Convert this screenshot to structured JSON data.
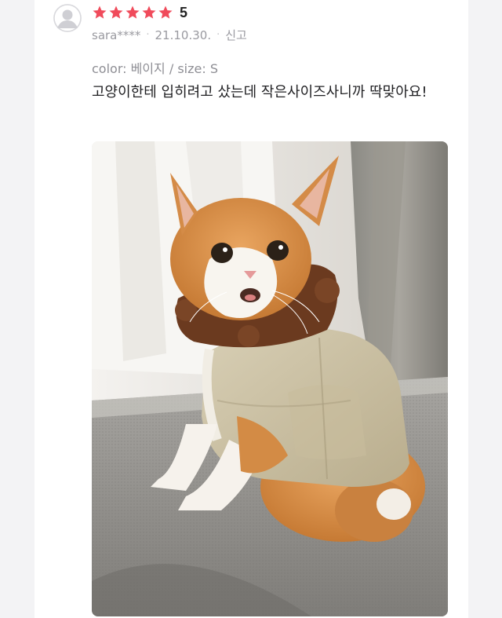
{
  "review": {
    "avatar_icon": "user-silhouette-icon",
    "rating": {
      "stars_filled": 5,
      "stars_total": 5,
      "value": "5",
      "star_color": "#f04b5b"
    },
    "author": "sara****",
    "date": "21.10.30.",
    "report_label": "신고",
    "option": "color: 베이지 / size: S",
    "text": "고양이한테 입히려고 샀는데 작은사이즈사니까 딱맞아요!"
  }
}
